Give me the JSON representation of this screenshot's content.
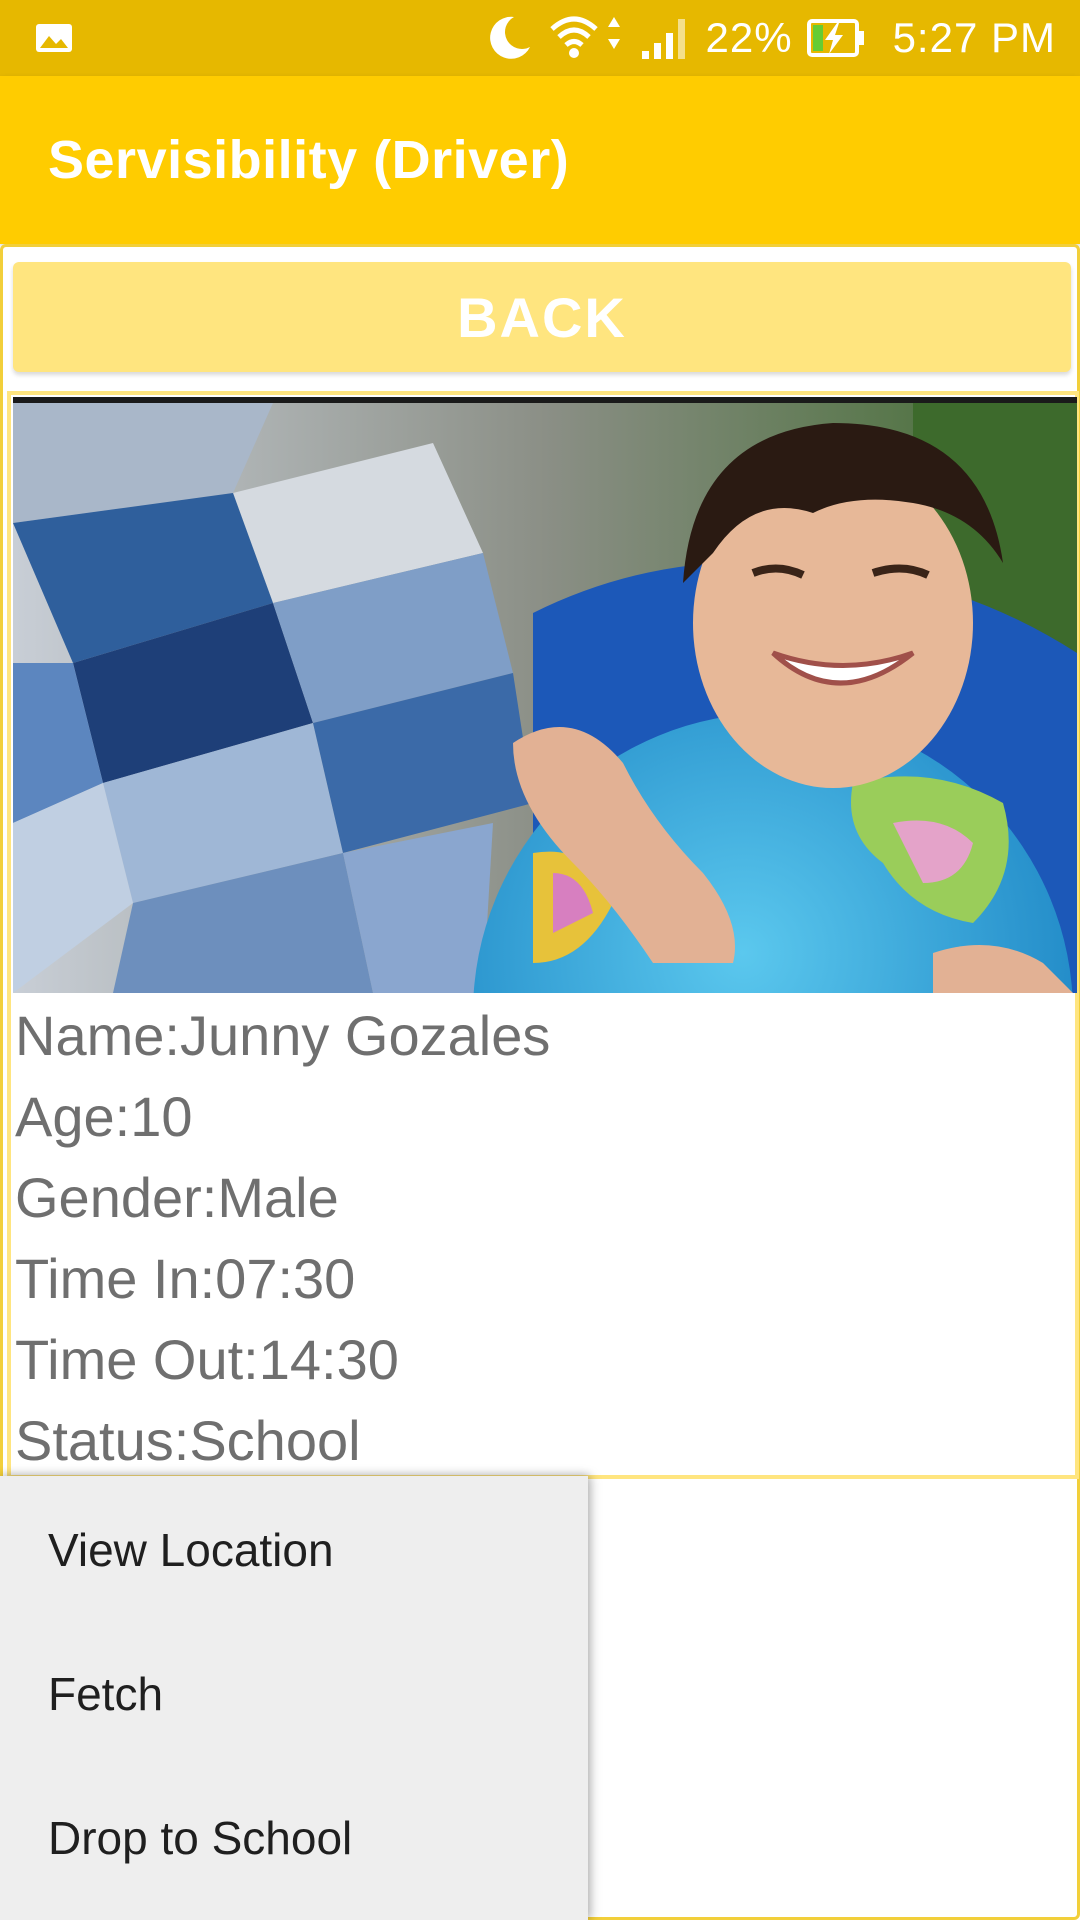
{
  "status_bar": {
    "battery_percent": "22%",
    "time": "5:27 PM",
    "icons": [
      "gallery-notification-icon",
      "moon-icon",
      "wifi-icon",
      "signal-icon",
      "battery-charging-icon"
    ],
    "background_color": "#e6b800"
  },
  "app_bar": {
    "title": "Servisibility (Driver)",
    "background_color": "#ffcc00"
  },
  "back_button": {
    "label": "BACK"
  },
  "child": {
    "name": "Name:Junny Gozales",
    "age": "Age:10",
    "gender": "Gender:Male",
    "time_in": "Time In:07:30",
    "time_out": "Time Out:14:30",
    "status": "Status:School"
  },
  "menu": {
    "items": [
      {
        "label": "View Location"
      },
      {
        "label": "Fetch"
      },
      {
        "label": "Drop to School"
      }
    ]
  },
  "colors": {
    "accent": "#ffcc00",
    "button_bg": "#ffe57f",
    "text_gray": "#6f6f6f"
  }
}
